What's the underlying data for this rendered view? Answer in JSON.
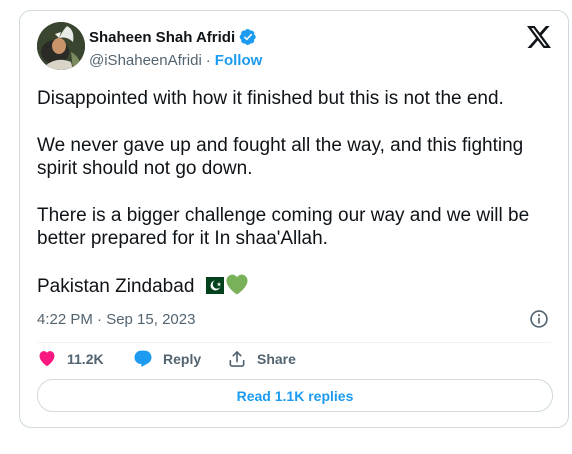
{
  "author": {
    "name": "Shaheen Shah Afridi",
    "handle": "@iShaheenAfridi",
    "separator": "·",
    "follow_label": "Follow"
  },
  "tweet": {
    "paragraphs": [
      "Disappointed with how it finished but this is not the end.",
      "We never gave up and fought all the way, and this fighting spirit should not go down.",
      "There is a bigger challenge coming our way and we will be better prepared for it In shaa'Allah."
    ],
    "closing_line": "Pakistan Zindabad",
    "emojis": [
      "pakistan-flag",
      "green-heart"
    ],
    "timestamp": "4:22 PM · Sep 15, 2023"
  },
  "actions": {
    "like_count": "11.2K",
    "reply_label": "Reply",
    "share_label": "Share",
    "read_replies_label": "Read 1.1K replies"
  },
  "colors": {
    "accent": "#1d9bf0",
    "like": "#f91880",
    "text": "#0f1419",
    "muted": "#536471",
    "border": "#cfd9de",
    "green_heart": "#78b159",
    "flag_green": "#01411c"
  }
}
